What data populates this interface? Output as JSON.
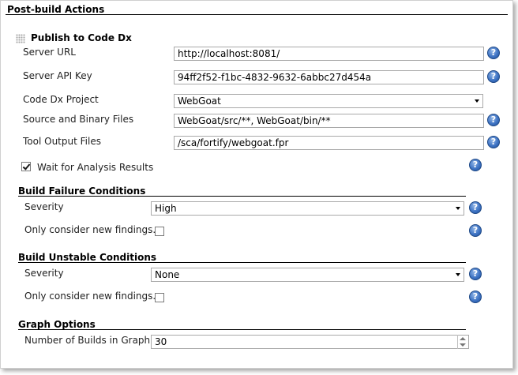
{
  "post_build": {
    "title": "Post-build Actions",
    "publisher": {
      "title": "Publish to Code Dx",
      "server_url": {
        "label": "Server URL",
        "value": "http://localhost:8081/"
      },
      "server_api_key": {
        "label": "Server API Key",
        "value": "94ff2f52-f1bc-4832-9632-6abbc27d454a"
      },
      "project": {
        "label": "Code Dx Project",
        "value": "WebGoat"
      },
      "source_files": {
        "label": "Source and Binary Files",
        "value": "WebGoat/src/**, WebGoat/bin/**"
      },
      "tool_output": {
        "label": "Tool Output Files",
        "value": "/sca/fortify/webgoat.fpr"
      },
      "wait": {
        "label": "Wait for Analysis Results",
        "checked": true
      }
    },
    "build_failure": {
      "title": "Build Failure Conditions",
      "severity": {
        "label": "Severity",
        "value": "High"
      },
      "new_findings": {
        "label": "Only consider new findings.",
        "checked": false
      }
    },
    "build_unstable": {
      "title": "Build Unstable Conditions",
      "severity": {
        "label": "Severity",
        "value": "None"
      },
      "new_findings": {
        "label": "Only consider new findings.",
        "checked": false
      }
    },
    "graph": {
      "title": "Graph Options",
      "num_builds": {
        "label": "Number of Builds in Graph",
        "value": "30"
      }
    }
  },
  "help_glyph": "?",
  "icons": {
    "help": "help-icon",
    "grip": "drag-grip-icon"
  }
}
